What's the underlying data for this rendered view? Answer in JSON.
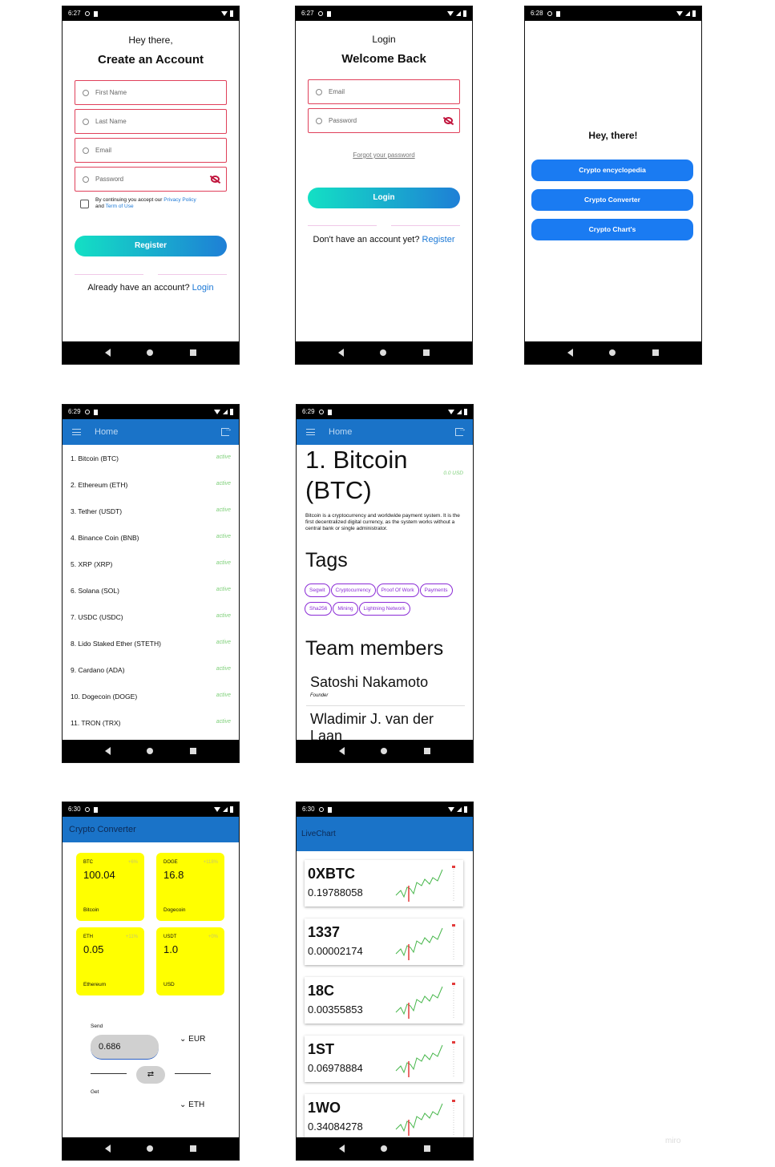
{
  "status_times": [
    "6:27",
    "6:27",
    "6:28",
    "6:29",
    "6:29",
    "6:30",
    "6:30"
  ],
  "register": {
    "greeting": "Hey there,",
    "title": "Create an Account",
    "first_name_placeholder": "First Name",
    "last_name_placeholder": "Last Name",
    "email_placeholder": "Email",
    "password_placeholder": "Password",
    "terms_prefix": "By continuing you accept our",
    "privacy_link": "Privacy Policy",
    "and": "and",
    "terms_link": "Term of Use",
    "register_button": "Register",
    "have_account": "Already have an account?",
    "login_link": "Login"
  },
  "login": {
    "greeting": "Login",
    "title": "Welcome Back",
    "email_placeholder": "Email",
    "password_placeholder": "Password",
    "forgot": "Forgot your password",
    "login_button": "Login",
    "no_account": "Don't have an account yet?",
    "register_link": "Register"
  },
  "menu": {
    "title": "Hey, there!",
    "buttons": [
      "Crypto encyclopedia",
      "Crypto Converter",
      "Crypto Chart's"
    ]
  },
  "home": {
    "appbar_title": "Home",
    "coins": [
      {
        "name": "1. Bitcoin (BTC)",
        "status": "active"
      },
      {
        "name": "2. Ethereum (ETH)",
        "status": "active"
      },
      {
        "name": "3. Tether (USDT)",
        "status": "active"
      },
      {
        "name": "4. Binance Coin (BNB)",
        "status": "active"
      },
      {
        "name": "5. XRP (XRP)",
        "status": "active"
      },
      {
        "name": "6. Solana (SOL)",
        "status": "active"
      },
      {
        "name": "7. USDC (USDC)",
        "status": "active"
      },
      {
        "name": "8. Lido Staked Ether (STETH)",
        "status": "active"
      },
      {
        "name": "9. Cardano (ADA)",
        "status": "active"
      },
      {
        "name": "10. Dogecoin (DOGE)",
        "status": "active"
      },
      {
        "name": "11. TRON (TRX)",
        "status": "active"
      }
    ]
  },
  "detail": {
    "appbar_title": "Home",
    "title_line1": "1. Bitcoin",
    "title_line2": "(BTC)",
    "price": "0.0 USD",
    "description": "Bitcoin is a cryptocurrency and worldwide payment system. It is the first decentralized digital currency, as the system works without a central bank or single administrator.",
    "tags_heading": "Tags",
    "tags": [
      "Segwit",
      "Cryptocurrency",
      "Proof Of Work",
      "Payments",
      "Sha256",
      "Mining",
      "Lightning Network"
    ],
    "team_heading": "Team members",
    "members": [
      {
        "name": "Satoshi Nakamoto",
        "role": "Founder"
      },
      {
        "name": "Wladimir J. van der Laan",
        "role": ""
      }
    ]
  },
  "converter": {
    "appbar_title": "Crypto Converter",
    "cards": [
      {
        "symbol": "BTC",
        "change": "+6%",
        "value": "100.04",
        "name": "Bitcoin"
      },
      {
        "symbol": "DOGE",
        "change": "+118%",
        "value": "16.8",
        "name": "Dogecoin"
      },
      {
        "symbol": "ETH",
        "change": "+11%",
        "value": "0.05",
        "name": "Ethereum"
      },
      {
        "symbol": "USDT",
        "change": "+0%",
        "value": "1.0",
        "name": "USD"
      }
    ],
    "send_label": "Send",
    "send_value": "0.686",
    "send_currency": "EUR",
    "get_label": "Get",
    "get_currency": "ETH"
  },
  "livechart": {
    "appbar_title": "LiveChart",
    "items": [
      {
        "symbol": "0XBTC",
        "price": "0.19788058"
      },
      {
        "symbol": "1337",
        "price": "0.00002174"
      },
      {
        "symbol": "18C",
        "price": "0.00355853"
      },
      {
        "symbol": "1ST",
        "price": "0.06978884"
      },
      {
        "symbol": "1WO",
        "price": "0.34084278"
      }
    ]
  },
  "watermark": "miro",
  "colors": {
    "accent_blue": "#1a73c8",
    "button_blue": "#1a7bf2",
    "field_border": "#e0405a",
    "card_yellow": "#ffff00",
    "active_green": "#7fd07a",
    "tag_purple": "#8a2bd6"
  }
}
